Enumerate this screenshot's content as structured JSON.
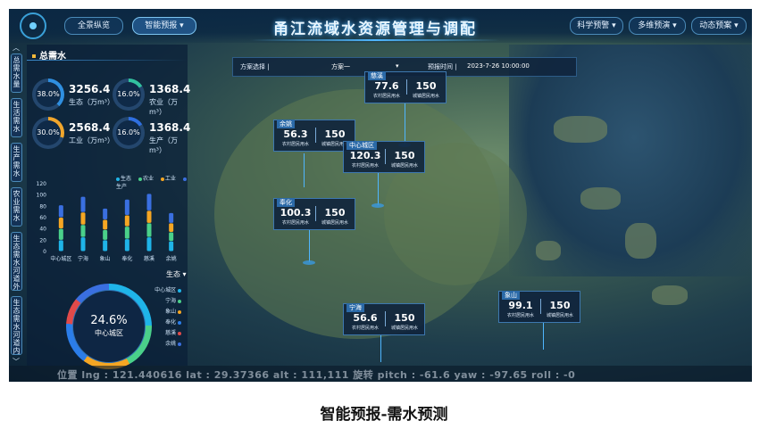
{
  "header": {
    "title": "甬江流域水资源管理与调配",
    "left_nav": [
      "全景纵览",
      "智能预报"
    ],
    "right_nav": [
      "科学预警",
      "多维预演",
      "动态预案"
    ]
  },
  "sidebar": {
    "tabs": [
      "总需水量",
      "生活需水",
      "生产需水",
      "农业需水",
      "生态需水河道外",
      "生态需水河道内"
    ]
  },
  "left_panel": {
    "title": "总需水",
    "metrics": [
      {
        "pct": "38.0%",
        "value": "3256.4",
        "label": "生态（万m³）",
        "color": "#2f8fe0"
      },
      {
        "pct": "16.0%",
        "value": "1368.4",
        "label": "农业（万m³）",
        "color": "#32c2a0"
      },
      {
        "pct": "30.0%",
        "value": "2568.4",
        "label": "工业（万m³）",
        "color": "#f1a62c"
      },
      {
        "pct": "16.0%",
        "value": "1368.4",
        "label": "生产（万m³）",
        "color": "#2f6fe0"
      }
    ],
    "legend": [
      "生态",
      "农业",
      "工业",
      "生产"
    ],
    "legend_colors": [
      "#1fb4e8",
      "#4ad08a",
      "#f5a623",
      "#3a6fe0"
    ],
    "life_dropdown": "生态",
    "ring_pct": "24.6%",
    "ring_label": "中心城区",
    "areas": [
      "中心城区",
      "宁海",
      "象山",
      "奉化",
      "慈溪",
      "余姚"
    ],
    "area_colors": [
      "#1fb4e8",
      "#4ad08a",
      "#f5a623",
      "#2b7de9",
      "#e04a4a",
      "#3a6fe0"
    ]
  },
  "chart_data": {
    "type": "bar",
    "stacked": true,
    "categories": [
      "中心城区",
      "宁海",
      "象山",
      "奉化",
      "慈溪",
      "余姚"
    ],
    "series": [
      {
        "name": "生态",
        "values": [
          20,
          25,
          20,
          22,
          25,
          18
        ]
      },
      {
        "name": "农业",
        "values": [
          20,
          22,
          18,
          22,
          25,
          16
        ]
      },
      {
        "name": "工业",
        "values": [
          20,
          22,
          18,
          20,
          22,
          16
        ]
      },
      {
        "name": "生产",
        "values": [
          22,
          28,
          20,
          28,
          30,
          18
        ]
      }
    ],
    "yticks": [
      "0",
      "20",
      "40",
      "60",
      "80",
      "100",
      "120"
    ],
    "ylim": [
      0,
      120
    ]
  },
  "control": {
    "scheme_label": "方案选择",
    "scheme_value": "方案一",
    "time_label": "预报时间",
    "time_value": "2023-7-26 10:00:00"
  },
  "popups": [
    {
      "name": "慈溪",
      "rural": "77.6",
      "urban": "150",
      "rural_label": "农村居民用水",
      "urban_label": "城镇居民用水"
    },
    {
      "name": "余姚",
      "rural": "56.3",
      "urban": "150",
      "rural_label": "农村居民用水",
      "urban_label": "城镇居民用水"
    },
    {
      "name": "中心城区",
      "rural": "120.3",
      "urban": "150",
      "rural_label": "农村居民用水",
      "urban_label": "城镇居民用水"
    },
    {
      "name": "奉化",
      "rural": "100.3",
      "urban": "150",
      "rural_label": "农村居民用水",
      "urban_label": "城镇居民用水"
    },
    {
      "name": "宁海",
      "rural": "56.6",
      "urban": "150",
      "rural_label": "农村居民用水",
      "urban_label": "城镇居民用水"
    },
    {
      "name": "象山",
      "rural": "99.1",
      "urban": "150",
      "rural_label": "农村居民用水",
      "urban_label": "城镇居民用水"
    }
  ],
  "footer": {
    "text": "位置 lng : 121.440616 lat : 29.37366 alt : 111,111   旋转 pitch : -61.6 yaw : -97.65 roll : -0"
  },
  "caption": "智能预报-需水预测"
}
